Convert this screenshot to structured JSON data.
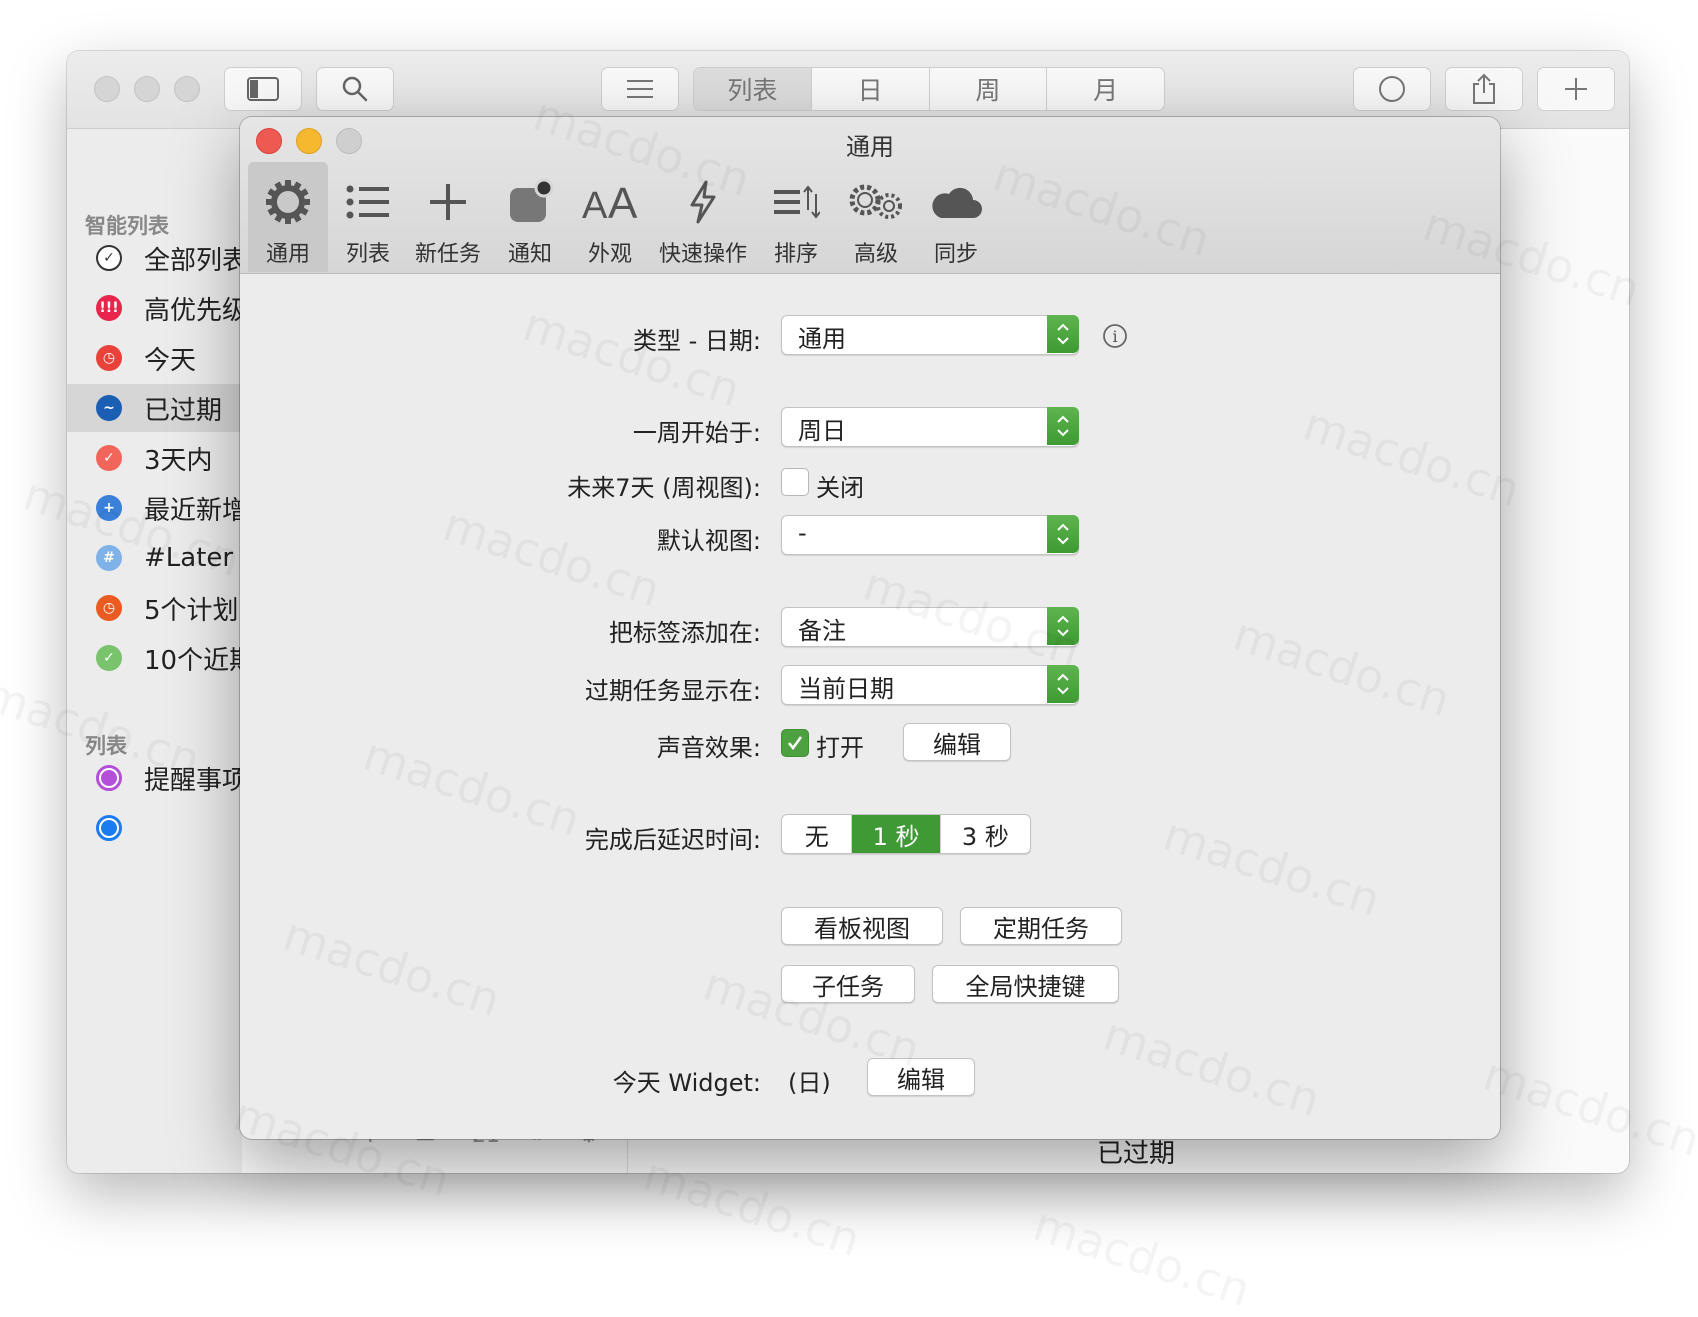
{
  "main_window": {
    "view_tabs": [
      "列表",
      "日",
      "周",
      "月"
    ],
    "active_view_tab": 0,
    "smart_lists_title": "智能列表",
    "smart_lists": [
      {
        "label": "全部列表",
        "icon": "check-circle-icon",
        "color": "#ffffff",
        "glyph": "✓"
      },
      {
        "label": "高优先级",
        "icon": "priority-icon",
        "color": "#e8264b",
        "glyph": "!!!"
      },
      {
        "label": "今天",
        "icon": "clock-icon",
        "color": "#e8423a",
        "glyph": "◷"
      },
      {
        "label": "已过期",
        "icon": "overdue-icon",
        "color": "#1b5fb5",
        "glyph": "~"
      },
      {
        "label": "3天内",
        "icon": "check-icon",
        "color": "#f2655a",
        "glyph": "✓"
      },
      {
        "label": "最近新增",
        "icon": "plus-icon",
        "color": "#3a7fd9",
        "glyph": "+"
      },
      {
        "label": "#Later",
        "icon": "hash-icon",
        "color": "#7fb2e8",
        "glyph": "#"
      },
      {
        "label": "5个计划",
        "icon": "clock-icon",
        "color": "#ea5a21",
        "glyph": "◷"
      },
      {
        "label": "10个近期",
        "icon": "check-icon",
        "color": "#79c36c",
        "glyph": "✓"
      }
    ],
    "selected_smart_list": 3,
    "lists_title": "列表",
    "lists": [
      {
        "label": "提醒事项",
        "color": "#b34fd9"
      },
      {
        "label": "",
        "color": "#1a7cf0"
      }
    ],
    "bottom_title": "已过期",
    "bottom_icons": [
      "P",
      "▭",
      "21",
      "»",
      "⚙"
    ]
  },
  "prefs": {
    "title": "通用",
    "tabs": [
      {
        "label": "通用",
        "icon": "gear-icon"
      },
      {
        "label": "列表",
        "icon": "list-icon"
      },
      {
        "label": "新任务",
        "icon": "plus-icon"
      },
      {
        "label": "通知",
        "icon": "notification-icon"
      },
      {
        "label": "外观",
        "icon": "text-size-icon"
      },
      {
        "label": "快速操作",
        "icon": "lightning-icon"
      },
      {
        "label": "排序",
        "icon": "sort-icon"
      },
      {
        "label": "高级",
        "icon": "gears-icon"
      },
      {
        "label": "同步",
        "icon": "cloud-icon"
      }
    ],
    "active_tab": 0,
    "date_type": {
      "label": "类型 - 日期:",
      "value": "通用"
    },
    "week_start": {
      "label": "一周开始于:",
      "value": "周日"
    },
    "next7": {
      "label": "未来7天 (周视图):",
      "checkbox_label": "关闭",
      "checked": false
    },
    "default_view": {
      "label": "默认视图:",
      "value": "-"
    },
    "tag_add": {
      "label": "把标签添加在:",
      "value": "备注"
    },
    "overdue_show": {
      "label": "过期任务显示在:",
      "value": "当前日期"
    },
    "sound": {
      "label": "声音效果:",
      "checkbox_label": "打开",
      "checked": true,
      "edit_label": "编辑"
    },
    "delay": {
      "label": "完成后延迟时间:",
      "options": [
        "无",
        "1 秒",
        "3 秒"
      ],
      "selected": 1
    },
    "buttons": [
      "看板视图",
      "定期任务",
      "子任务",
      "全局快捷键"
    ],
    "widget": {
      "label": "今天 Widget:",
      "value": "(日)",
      "edit_label": "编辑"
    }
  },
  "watermark_text": "macdo.cn",
  "colors": {
    "accent_green": "#3f9a35",
    "close": "#ee5a52",
    "minimize": "#f5b82e"
  }
}
